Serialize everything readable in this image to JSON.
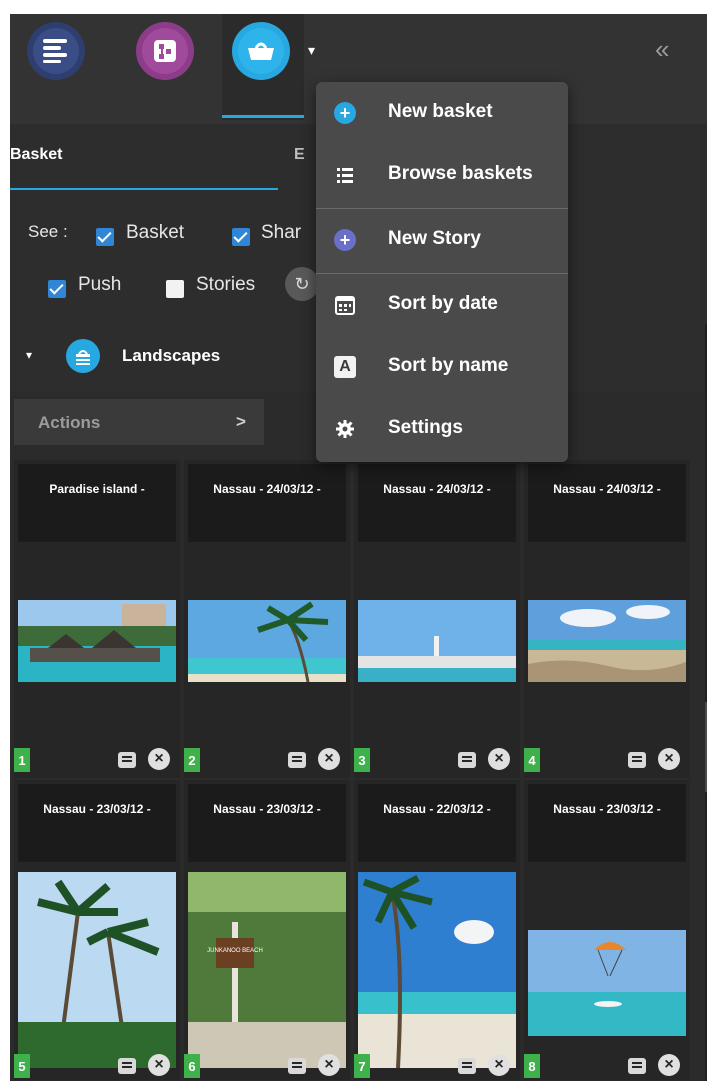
{
  "header": {
    "collapse_label": "«",
    "caret": "▾"
  },
  "tabs": [
    {
      "label": "Basket"
    },
    {
      "label": "E"
    }
  ],
  "filters": {
    "see_label": "See :",
    "options": [
      {
        "label": "Basket",
        "checked": true
      },
      {
        "label": "Shar",
        "checked": true
      },
      {
        "label": "Push",
        "checked": true
      },
      {
        "label": "Stories",
        "checked": false
      }
    ],
    "refresh_glyph": "↻",
    "extra_glyph": "x"
  },
  "section": {
    "title": "Landscapes",
    "caret": "▾"
  },
  "actions": {
    "label": "Actions",
    "arrow": ">"
  },
  "menu": {
    "items": [
      {
        "label": "New basket",
        "icon": "plus-circle-icon"
      },
      {
        "label": "Browse baskets",
        "icon": "list-icon"
      },
      {
        "label": "New Story",
        "icon": "plus-circle-icon"
      },
      {
        "label": "Sort by date",
        "icon": "calendar-icon"
      },
      {
        "label": "Sort by name",
        "icon": "letter-a-icon",
        "glyph": "A"
      },
      {
        "label": "Settings",
        "icon": "gear-icon"
      }
    ]
  },
  "cards": [
    {
      "number": "1",
      "title": "Paradise island -"
    },
    {
      "number": "2",
      "title": "Nassau - 24/03/12 -"
    },
    {
      "number": "3",
      "title": "Nassau - 24/03/12 -"
    },
    {
      "number": "4",
      "title": "Nassau - 24/03/12 -"
    },
    {
      "number": "5",
      "title": "Nassau - 23/03/12 -"
    },
    {
      "number": "6",
      "title": "Nassau - 23/03/12 -"
    },
    {
      "number": "7",
      "title": "Nassau - 22/03/12 -"
    },
    {
      "number": "8",
      "title": "Nassau - 23/03/12 -"
    }
  ],
  "photo_signs": {
    "beach_sign": "JUNKANOO BEACH"
  },
  "colors": {
    "accent": "#27a8e0",
    "checkbox": "#2f86d6",
    "badge": "#3fb14a",
    "menu_bg": "#4a4a4a"
  }
}
